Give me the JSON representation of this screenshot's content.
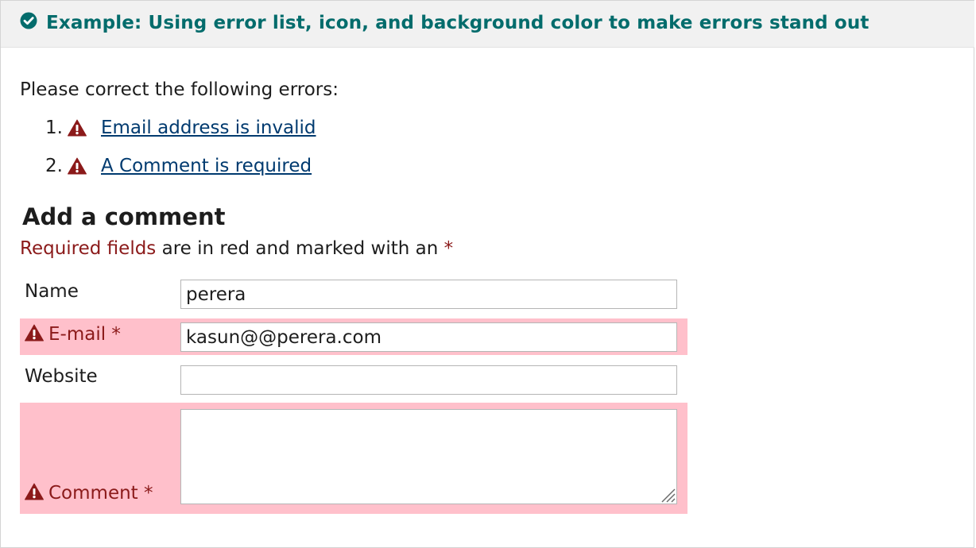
{
  "header": {
    "title": "Example: Using error list, icon, and background color to make errors stand out",
    "icon": "check-circle-icon",
    "color": "#036c6c"
  },
  "error_summary": {
    "intro": "Please correct the following errors:",
    "items": [
      {
        "number": "1.",
        "icon": "warning-icon",
        "label": "Email address is invalid"
      },
      {
        "number": "2.",
        "icon": "warning-icon",
        "label": "A Comment is required"
      }
    ]
  },
  "form": {
    "title": "Add a comment",
    "required_note": {
      "highlight": "Required fields",
      "text": " are in red and marked with an ",
      "asterisk": "*"
    },
    "fields": {
      "name": {
        "label": "Name",
        "value": "perera"
      },
      "email": {
        "label": "E-mail *",
        "value": "kasun@@perera.com",
        "error": true,
        "icon": "warning-icon"
      },
      "website": {
        "label": "Website",
        "value": ""
      },
      "comment": {
        "label": "Comment *",
        "value": "",
        "error": true,
        "icon": "warning-icon"
      }
    }
  },
  "colors": {
    "error_background": "#ffc0cb",
    "error_text": "#8b1a1a",
    "link": "#003a6f"
  }
}
